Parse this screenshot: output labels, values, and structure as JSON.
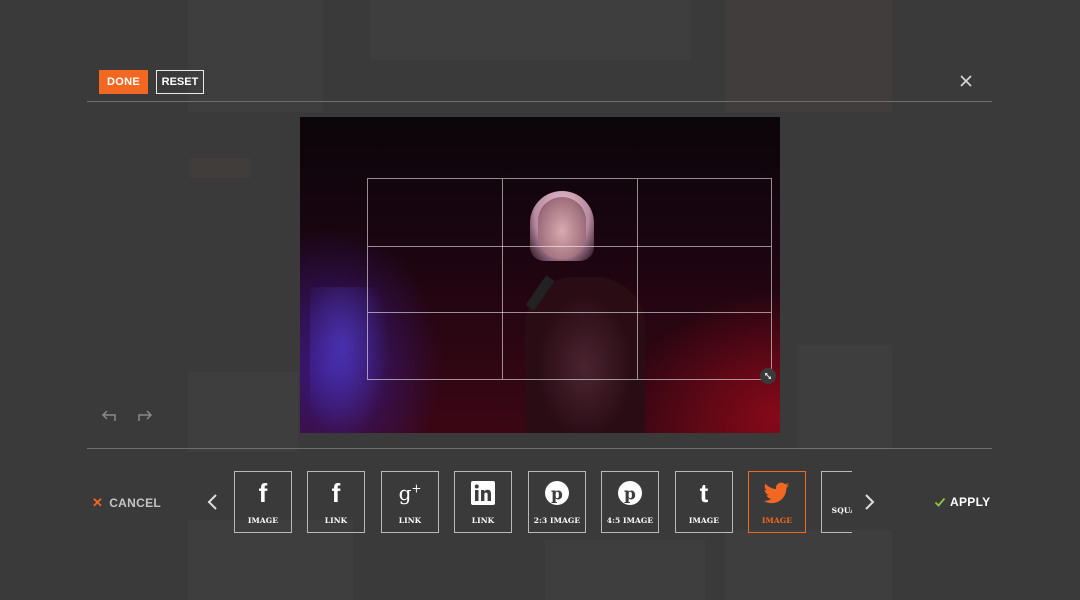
{
  "toolbar": {
    "done_label": "DONE",
    "reset_label": "RESET",
    "close_icon": "close-icon"
  },
  "editor": {
    "undo_icon": "undo-icon",
    "redo_icon": "redo-icon",
    "resize_icon": "resize-handle-icon"
  },
  "footer": {
    "cancel_label": "CANCEL",
    "apply_label": "APPLY"
  },
  "presets": [
    {
      "icon": "facebook-icon",
      "label": "IMAGE",
      "active": false
    },
    {
      "icon": "facebook-icon",
      "label": "LINK",
      "active": false
    },
    {
      "icon": "google-plus-icon",
      "label": "LINK",
      "active": false
    },
    {
      "icon": "linkedin-icon",
      "label": "LINK",
      "active": false
    },
    {
      "icon": "pinterest-icon",
      "label": "2:3 IMAGE",
      "active": false
    },
    {
      "icon": "pinterest-icon",
      "label": "4:5 IMAGE",
      "active": false
    },
    {
      "icon": "tumblr-icon",
      "label": "IMAGE",
      "active": false
    },
    {
      "icon": "twitter-icon",
      "label": "IMAGE",
      "active": true
    },
    {
      "icon": "square-icon",
      "label": "SQUARE",
      "active": false
    }
  ],
  "colors": {
    "accent": "#f26722",
    "apply_check": "#8cc63f"
  }
}
